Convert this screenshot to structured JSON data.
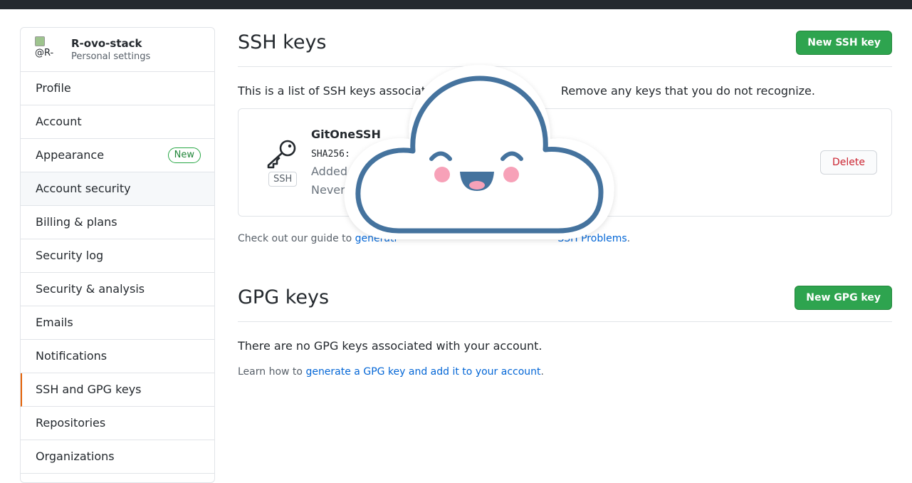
{
  "sidebar": {
    "avatar_alt": "@R-",
    "username": "R-ovo-stack",
    "subtitle": "Personal settings",
    "items": [
      {
        "label": "Profile"
      },
      {
        "label": "Account"
      },
      {
        "label": "Appearance",
        "badge": "New"
      },
      {
        "label": "Account security"
      },
      {
        "label": "Billing & plans"
      },
      {
        "label": "Security log"
      },
      {
        "label": "Security & analysis"
      },
      {
        "label": "Emails"
      },
      {
        "label": "Notifications"
      },
      {
        "label": "SSH and GPG keys"
      },
      {
        "label": "Repositories"
      },
      {
        "label": "Organizations"
      }
    ]
  },
  "ssh": {
    "title": "SSH keys",
    "new_button": "New SSH key",
    "intro_left": "This is a list of SSH keys associate",
    "intro_right": "Remove any keys that you do not recognize.",
    "key": {
      "name": "GitOneSSH",
      "fingerprint_prefix": "SHA256:",
      "added_prefix": "Added",
      "last_used_prefix": "Never",
      "tag": "SSH",
      "delete_button": "Delete"
    },
    "guide_prefix": "Check out our guide to",
    "guide_link_partial": "generati",
    "guide_link_end": "SSH Problems",
    "guide_suffix": "."
  },
  "gpg": {
    "title": "GPG keys",
    "new_button": "New GPG key",
    "empty_text": "There are no GPG keys associated with your account.",
    "learn_prefix": "Learn how to",
    "learn_link": "generate a GPG key and add it to your account",
    "learn_suffix": "."
  },
  "colors": {
    "accent_green": "#2ea44f",
    "link_blue": "#0366d6",
    "danger_red": "#cb2431",
    "selected_border": "#e36209",
    "cloud_stroke": "#45739e",
    "cheek_pink": "#f7a1b8"
  }
}
